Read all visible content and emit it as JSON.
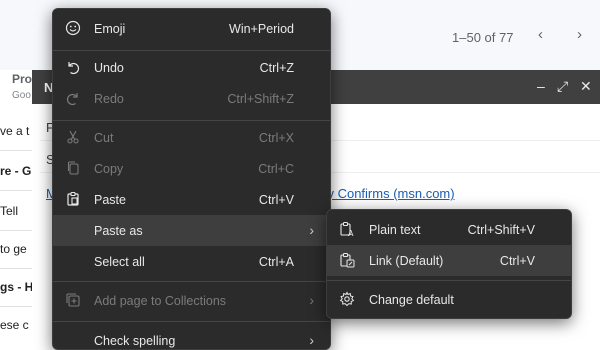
{
  "background": {
    "pager_text": "1–50 of 77",
    "prev_icon": "chevron-left-icon",
    "next_icon": "chevron-right-icon",
    "compose_title_fragment": "N",
    "compose_subject_fragment": "Pro",
    "compose_subject_sub": "Goo",
    "row_fragments": [
      "ve a t",
      "re - G",
      "Tell",
      "to ge",
      "gs - H",
      "ese c"
    ],
    "field_letters": [
      "F",
      "S"
    ],
    "link_prefix": "M",
    "link_suffix": "ody Confirms (msn.com)"
  },
  "context_menu": {
    "items": [
      {
        "label": "Emoji",
        "shortcut": "Win+Period",
        "icon": "emoji-icon",
        "enabled": true
      },
      {
        "label": "Undo",
        "shortcut": "Ctrl+Z",
        "icon": "undo-icon",
        "enabled": true
      },
      {
        "label": "Redo",
        "shortcut": "Ctrl+Shift+Z",
        "icon": "redo-icon",
        "enabled": false
      },
      {
        "label": "Cut",
        "shortcut": "Ctrl+X",
        "icon": "cut-icon",
        "enabled": false
      },
      {
        "label": "Copy",
        "shortcut": "Ctrl+C",
        "icon": "copy-icon",
        "enabled": false
      },
      {
        "label": "Paste",
        "shortcut": "Ctrl+V",
        "icon": "paste-icon",
        "enabled": true
      },
      {
        "label": "Paste as",
        "shortcut": "",
        "icon": "",
        "enabled": true,
        "submenu": true,
        "highlighted": true
      },
      {
        "label": "Select all",
        "shortcut": "Ctrl+A",
        "icon": "",
        "enabled": true
      },
      {
        "label": "Add page to Collections",
        "shortcut": "",
        "icon": "collections-icon",
        "enabled": false,
        "submenu": true
      },
      {
        "label": "Check spelling",
        "shortcut": "",
        "icon": "",
        "enabled": true,
        "submenu": true
      }
    ]
  },
  "paste_as_submenu": {
    "items": [
      {
        "label": "Plain text",
        "shortcut": "Ctrl+Shift+V",
        "icon": "plain-text-icon"
      },
      {
        "label": "Link (Default)",
        "shortcut": "Ctrl+V",
        "icon": "link-paste-icon",
        "highlighted": true
      },
      {
        "label": "Change default",
        "shortcut": "",
        "icon": "gear-icon"
      }
    ]
  },
  "colors": {
    "menu_bg": "#2b2b2b",
    "menu_highlight": "#3e3e3e",
    "menu_text": "#e8e8e8",
    "menu_disabled_text": "#7b7b7b",
    "link": "#1a5fb4"
  }
}
